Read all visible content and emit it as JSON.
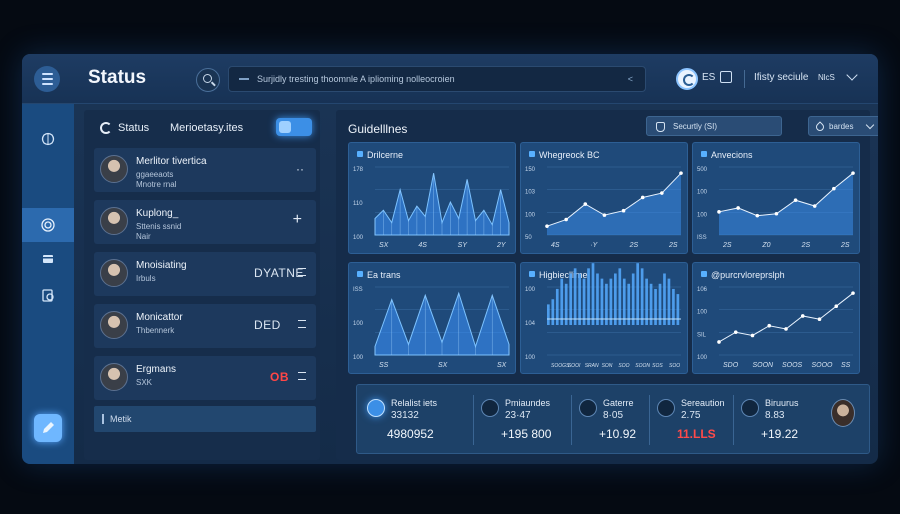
{
  "header": {
    "title": "Status",
    "search_text": "Surjidly tresting thoomnle A iplioming nolleocroien",
    "search_end": "&lt;",
    "icon_text": "ES",
    "user_label": "Ifisty seciule",
    "nick": "NlcS"
  },
  "rail": {
    "items": [
      "brain-icon",
      "radar-icon",
      "card-icon",
      "chart-doc-icon"
    ],
    "bottom": "app-launcher-icon"
  },
  "list": {
    "status_label": "Status",
    "tab_label": "Merioetasy.ites",
    "items": [
      {
        "name": "Merlitor tivertica",
        "sub1": "ggaeeaots",
        "sub2": "Mnotre rnal",
        "right": "··",
        "mid": "",
        "right_style": "normal"
      },
      {
        "name": "Kuplong_",
        "sub1": "Sttenis ssnid",
        "sub2": "Nair",
        "right": "+",
        "mid": "",
        "right_style": "big"
      },
      {
        "name": "Mnoisiating",
        "sub1": "Irbuls",
        "sub2": "",
        "right": "",
        "mid": "DYATNE",
        "right_style": "eq"
      },
      {
        "name": "Monicattor",
        "sub1": "Thbennerk",
        "sub2": "",
        "right": "",
        "mid": "DED",
        "right_style": "eq"
      },
      {
        "name": "Ergmans",
        "sub1": "SXK",
        "sub2": "",
        "right": "",
        "mid": "OB",
        "right_style": "eqred"
      }
    ],
    "footer": "Metik"
  },
  "main": {
    "title": "Guidelllnes",
    "security_select": "Securtly (SI)",
    "drop_select": "bardes"
  },
  "cards": [
    {
      "title": "Drilcerne",
      "yticks": [
        "178",
        "110",
        "100"
      ],
      "xticks": [
        "SX",
        "4S",
        "SY",
        "2Y"
      ]
    },
    {
      "title": "Whegreock BC",
      "yticks": [
        "150",
        "103",
        "100",
        "50"
      ],
      "xticks": [
        "4S",
        "·Y",
        "2S",
        "2S"
      ]
    },
    {
      "title": "Anvecions",
      "yticks": [
        "500",
        "100",
        "100",
        "ISS"
      ],
      "xticks": [
        "2S",
        "Z0",
        "2S",
        "2S"
      ]
    },
    {
      "title": "Ea trans",
      "yticks": [
        "ISS",
        "100",
        "100"
      ],
      "xticks": [
        "SS",
        "SX",
        "SX"
      ]
    },
    {
      "title": "Higbiecllime",
      "yticks": [
        "100",
        "104",
        "100"
      ],
      "xticks": [
        "SOOGS",
        "SOOI",
        "SRAN",
        "SON",
        "SOO",
        "SOON",
        "SOS",
        "SOO"
      ]
    },
    {
      "title": "@purcrvloreprslph",
      "yticks": [
        "106",
        "100",
        "SIL",
        "100"
      ],
      "xticks": [
        "SDO",
        "SOON",
        "SOOS",
        "SOOO",
        "SS"
      ]
    }
  ],
  "chart_data": [
    {
      "type": "area",
      "title": "Drilcerne",
      "values": [
        40,
        60,
        30,
        110,
        35,
        70,
        45,
        150,
        30,
        80,
        40,
        135,
        35,
        60,
        25,
        110,
        30
      ]
    },
    {
      "type": "line",
      "title": "Whegreock BC",
      "x": [
        0,
        1,
        2,
        3,
        4,
        5,
        6,
        7
      ],
      "values": [
        20,
        35,
        70,
        45,
        55,
        85,
        95,
        140
      ]
    },
    {
      "type": "line",
      "title": "Anvecions",
      "x": [
        0,
        1,
        2,
        3,
        4,
        5,
        6,
        7
      ],
      "values": [
        60,
        70,
        50,
        55,
        90,
        75,
        120,
        160
      ]
    },
    {
      "type": "area",
      "title": "Ea trans",
      "values": [
        20,
        130,
        25,
        140,
        30,
        145,
        20,
        140,
        25
      ]
    },
    {
      "type": "bar",
      "title": "Higbiecllime",
      "values": [
        8,
        10,
        14,
        18,
        16,
        20,
        22,
        20,
        18,
        22,
        24,
        20,
        18,
        16,
        18,
        20,
        22,
        18,
        16,
        20,
        24,
        22,
        18,
        16,
        14,
        16,
        20,
        18,
        14,
        12
      ]
    },
    {
      "type": "line",
      "title": "@purcrvloreprslph",
      "x": [
        0,
        1,
        2,
        3,
        4,
        5,
        6,
        7,
        8
      ],
      "values": [
        20,
        35,
        30,
        45,
        40,
        60,
        55,
        75,
        95
      ]
    }
  ],
  "stats": [
    {
      "label": "Relalist iets",
      "sub": "33132",
      "value": "4980952",
      "red": false
    },
    {
      "label": "Pmiaundes",
      "sub": "23·47",
      "value": "+195 800",
      "red": false
    },
    {
      "label": "Gaterre",
      "sub": "8·05",
      "value": "+10.92",
      "red": false
    },
    {
      "label": "Sereaution",
      "sub": "2.75",
      "value": "11.LLS",
      "red": true
    },
    {
      "label": "Biruurus",
      "sub": "8.83",
      "value": "+19.22",
      "red": false
    }
  ],
  "colors": {
    "accent": "#3c8fe6",
    "chart_fill": "#4aa3ff",
    "negative": "#ff4646"
  }
}
